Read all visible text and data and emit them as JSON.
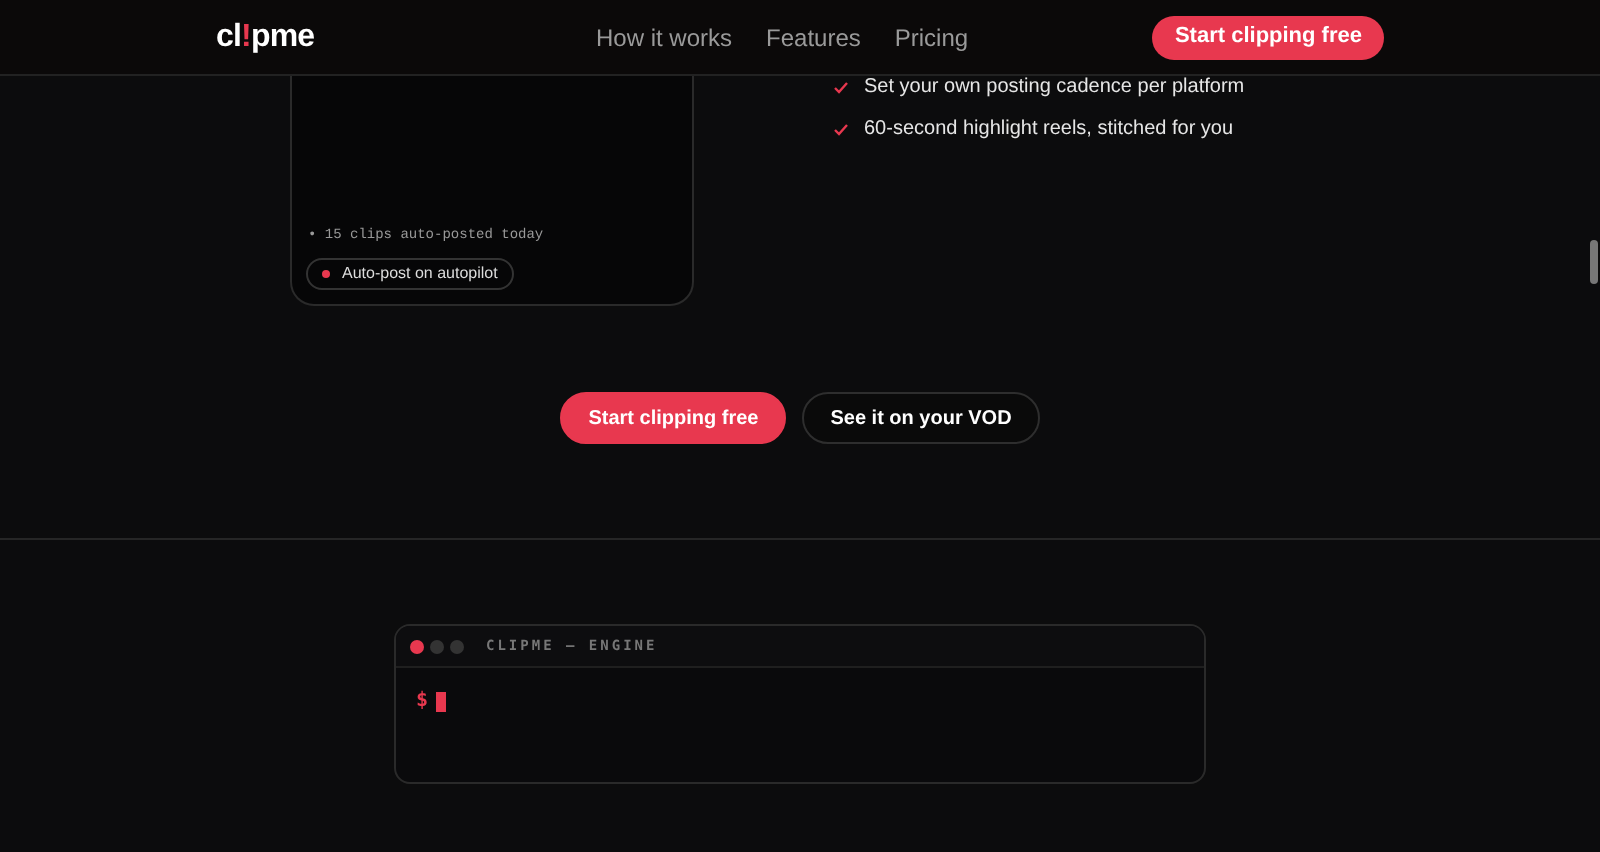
{
  "nav": {
    "logo": {
      "start": "cl",
      "accent": "!",
      "end": "pme"
    },
    "links": [
      "How it works",
      "Features",
      "Pricing"
    ],
    "cta": "Start clipping free"
  },
  "preview_card": {
    "status": "• 15 clips auto-posted today",
    "badge": "Auto-post on autopilot"
  },
  "features": [
    "Set your own posting cadence per platform",
    "60-second highlight reels, stitched for you"
  ],
  "actions": [
    {
      "label": "Start clipping free",
      "kind": "primary"
    },
    {
      "label": "See it on your VOD",
      "kind": "secondary"
    }
  ],
  "terminal": {
    "title": "CLIPME — ENGINE",
    "prompt": "$"
  }
}
